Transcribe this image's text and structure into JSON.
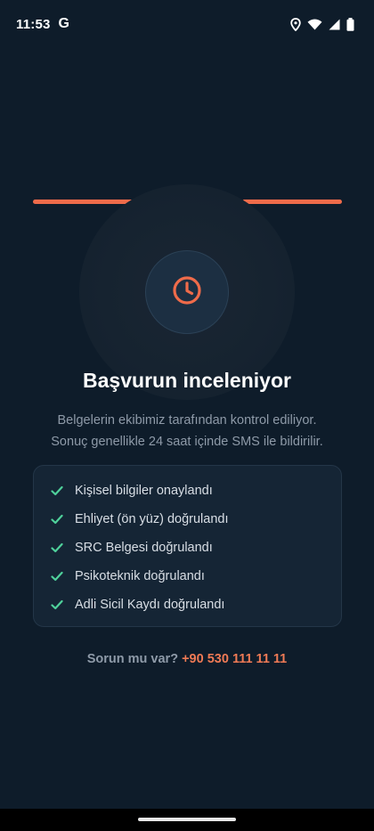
{
  "status_bar": {
    "time": "11:53",
    "google_icon_letter": "G",
    "icons": [
      "location-icon",
      "wifi-icon",
      "signal-icon",
      "battery-icon"
    ]
  },
  "progress": {
    "steps_total": 3,
    "steps_completed": 3,
    "color": "#ef6b4a"
  },
  "hero": {
    "icon": "clock-icon",
    "title": "Başvurun inceleniyor",
    "subtitle_line1": "Belgelerin ekibimiz tarafından kontrol ediliyor.",
    "subtitle_line2": "Sonuç genellikle 24 saat içinde SMS ile bildirilir."
  },
  "checklist": {
    "items": [
      {
        "label": "Kişisel bilgiler onaylandı",
        "icon": "check-icon"
      },
      {
        "label": "Ehliyet (ön yüz) doğrulandı",
        "icon": "check-icon"
      },
      {
        "label": "SRC Belgesi doğrulandı",
        "icon": "check-icon"
      },
      {
        "label": "Psikoteknik doğrulandı",
        "icon": "check-icon"
      },
      {
        "label": "Adli Sicil Kaydı doğrulandı",
        "icon": "check-icon"
      }
    ],
    "check_color": "#4fd19b"
  },
  "support": {
    "label": "Sorun mu var?",
    "phone": "+90 530 111 11 11"
  },
  "colors": {
    "background": "#0e1c2a",
    "accent": "#ef6b4a",
    "card": "#152535",
    "muted_text": "#8e9aa8"
  }
}
